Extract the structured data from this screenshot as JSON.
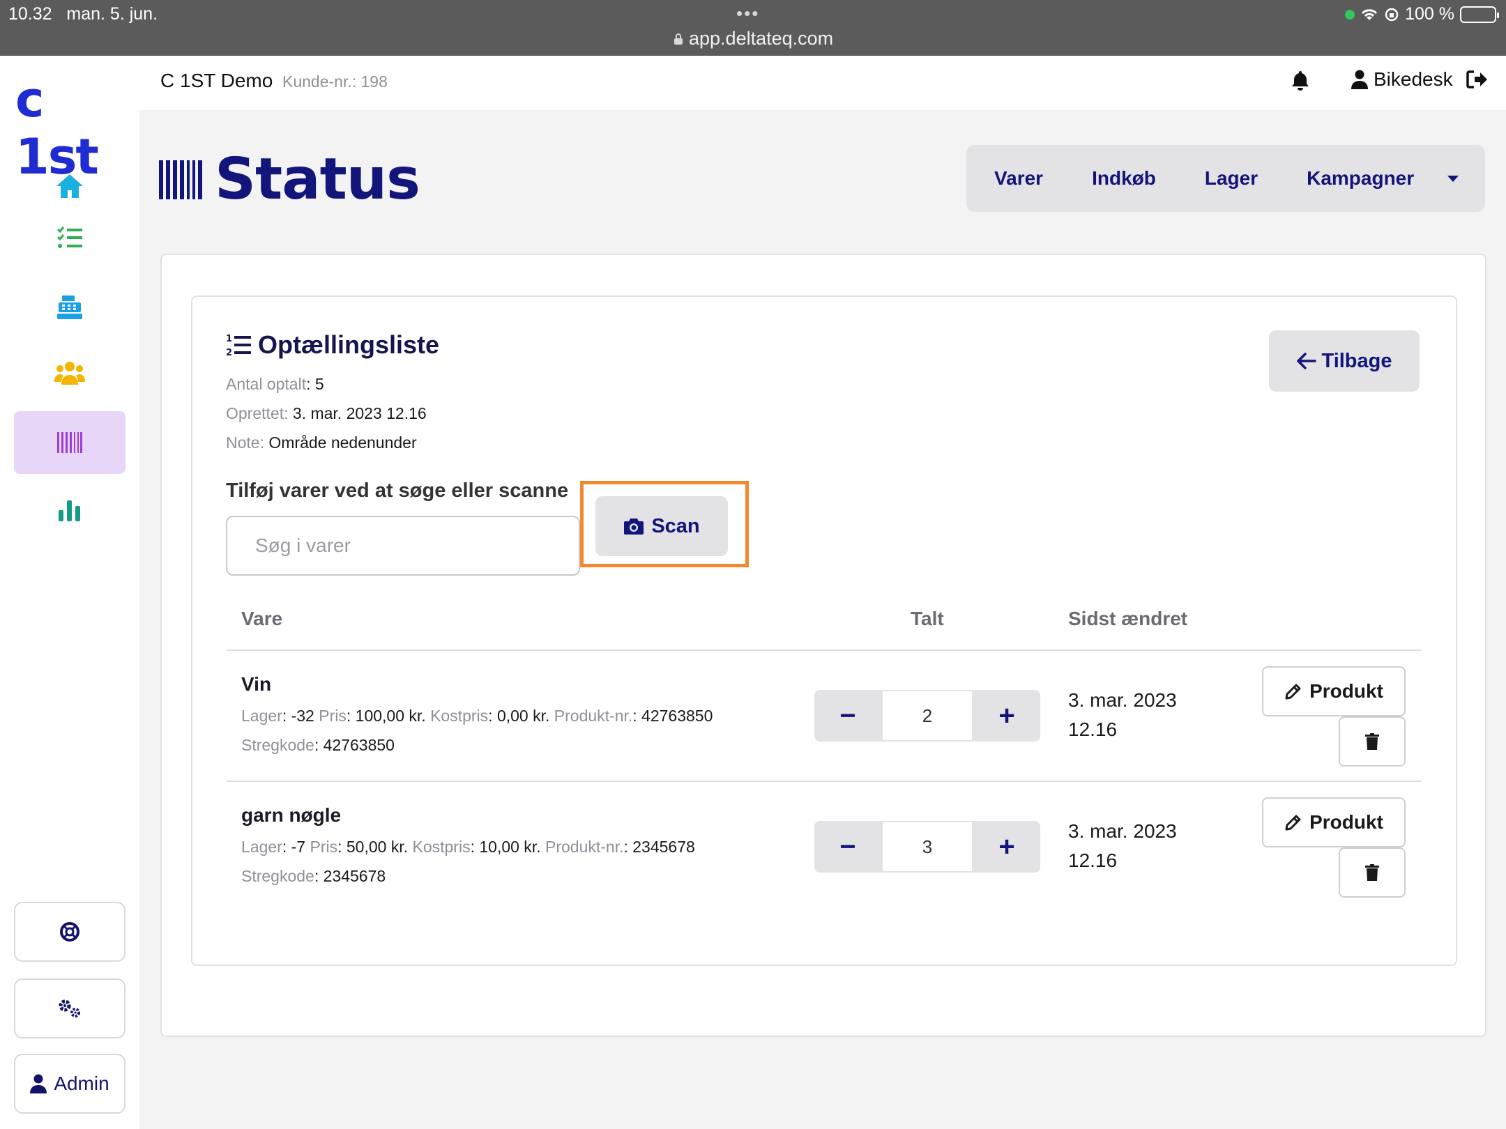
{
  "status_bar": {
    "time": "10.32",
    "date": "man. 5. jun.",
    "dots": "•••",
    "url": "app.deltateq.com",
    "battery": "100 %"
  },
  "sidebar": {
    "logo": "c 1st",
    "items": [
      {
        "name": "home",
        "icon": "home-icon",
        "color": "#1ab0e0"
      },
      {
        "name": "tasks",
        "icon": "checklist-icon",
        "color": "#2fae52"
      },
      {
        "name": "register",
        "icon": "cash-register-icon",
        "color": "#1aa0e8"
      },
      {
        "name": "customers",
        "icon": "users-icon",
        "color": "#f5b400"
      },
      {
        "name": "status",
        "icon": "barcode-icon",
        "color": "#9a3fd0",
        "active": true
      },
      {
        "name": "statistics",
        "icon": "bar-chart-icon",
        "color": "#149a86"
      }
    ],
    "help_icon": "lifebuoy-icon",
    "settings_icon": "gears-icon",
    "admin_label": "Admin"
  },
  "header": {
    "company": "C 1ST Demo",
    "customer_number": "Kunde-nr.: 198",
    "user": "Bikedesk"
  },
  "page": {
    "title": "Status",
    "nav": [
      "Varer",
      "Indkøb",
      "Lager",
      "Kampagner"
    ]
  },
  "count_list": {
    "title": "Optællingsliste",
    "counted_label": "Antal optalt",
    "counted_value": ": 5",
    "created_label": "Oprettet:",
    "created_value": " 3. mar. 2023 12.16",
    "note_label": "Note:",
    "note_value": " Område nedenunder",
    "back_label": "Tilbage",
    "add_label": "Tilføj varer ved at søge eller scanne",
    "search_placeholder": "Søg i varer",
    "scan_label": "Scan"
  },
  "table": {
    "headers": {
      "item": "Vare",
      "counted": "Talt",
      "changed": "Sidst ændret"
    },
    "labels": {
      "stock": "Lager",
      "price": "Pris",
      "cost": "Kostpris",
      "product_no": "Produkt-nr.",
      "barcode": "Stregkode"
    },
    "rows": [
      {
        "name": "Vin",
        "stock": ": -32 ",
        "price": ": 100,00 kr. ",
        "cost": ": 0,00 kr. ",
        "product_no": ": 42763850",
        "barcode": ": 42763850",
        "count": "2",
        "date_line1": "3. mar. 2023",
        "date_line2": "12.16",
        "product_btn": "Produkt"
      },
      {
        "name": "garn nøgle",
        "stock": ": -7 ",
        "price": ": 50,00 kr. ",
        "cost": ": 10,00 kr. ",
        "product_no": ": 2345678",
        "barcode": ": 2345678",
        "count": "3",
        "date_line1": "3. mar. 2023",
        "date_line2": "12.16",
        "product_btn": "Produkt"
      }
    ]
  },
  "colors": {
    "brand": "#12157a",
    "logo": "#1f2bd3",
    "highlight": "#f2892f",
    "active_nav": "#e7d6f8"
  }
}
